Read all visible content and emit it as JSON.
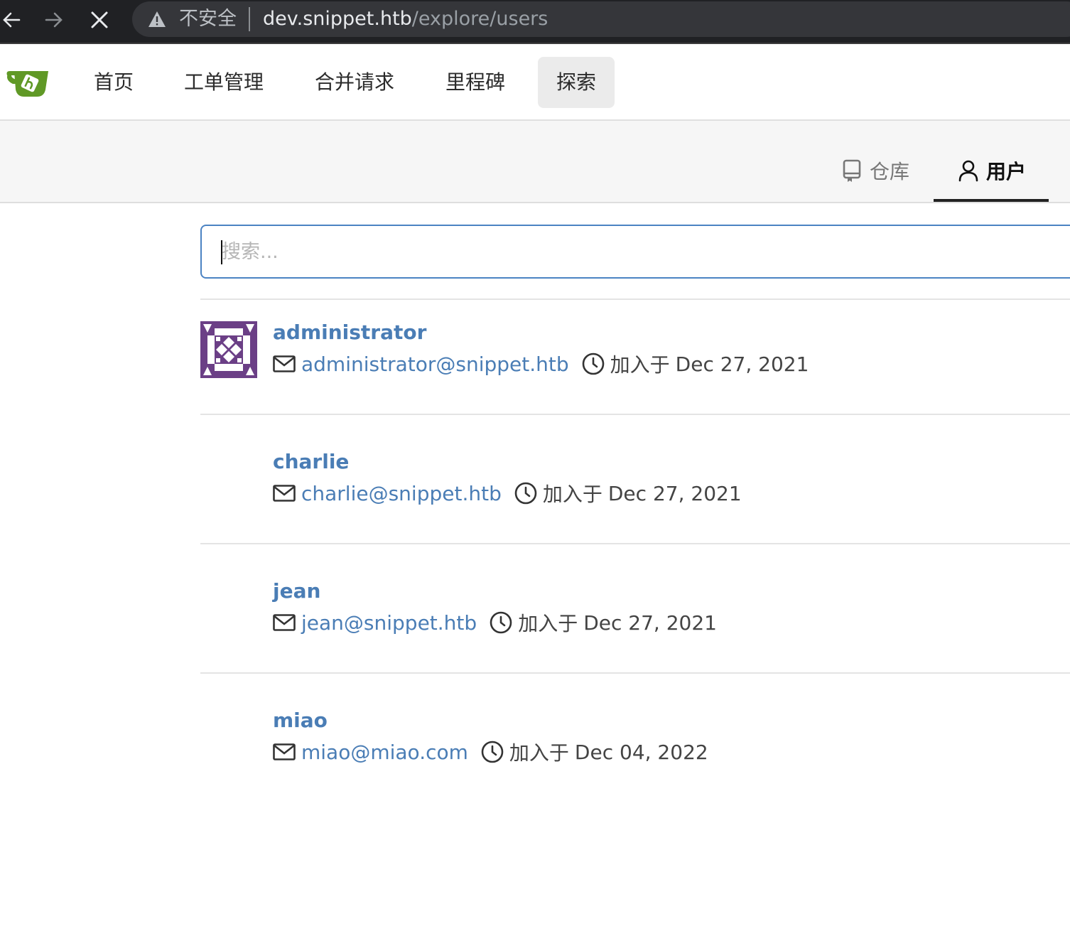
{
  "browser": {
    "security_label": "不安全",
    "url_host": "dev.snippet.htb",
    "url_path": "/explore/users"
  },
  "nav": {
    "items": [
      {
        "label": "首页"
      },
      {
        "label": "工单管理"
      },
      {
        "label": "合并请求"
      },
      {
        "label": "里程碑"
      },
      {
        "label": "探索",
        "active": true
      }
    ]
  },
  "explore_tabs": {
    "repos_label": "仓库",
    "users_label": "用户",
    "active": "users"
  },
  "search": {
    "placeholder": "搜索...",
    "value": ""
  },
  "users": [
    {
      "name": "administrator",
      "email": "administrator@snippet.htb",
      "joined_prefix": "加入于",
      "joined_date": "Dec 27, 2021",
      "has_avatar": true
    },
    {
      "name": "charlie",
      "email": "charlie@snippet.htb",
      "joined_prefix": "加入于",
      "joined_date": "Dec 27, 2021",
      "has_avatar": false
    },
    {
      "name": "jean",
      "email": "jean@snippet.htb",
      "joined_prefix": "加入于",
      "joined_date": "Dec 27, 2021",
      "has_avatar": false
    },
    {
      "name": "miao",
      "email": "miao@miao.com",
      "joined_prefix": "加入于",
      "joined_date": "Dec 04, 2022",
      "has_avatar": false
    }
  ],
  "colors": {
    "link": "#4a7db5",
    "logo_green": "#609926",
    "avatar_purple": "#6b3f86"
  }
}
